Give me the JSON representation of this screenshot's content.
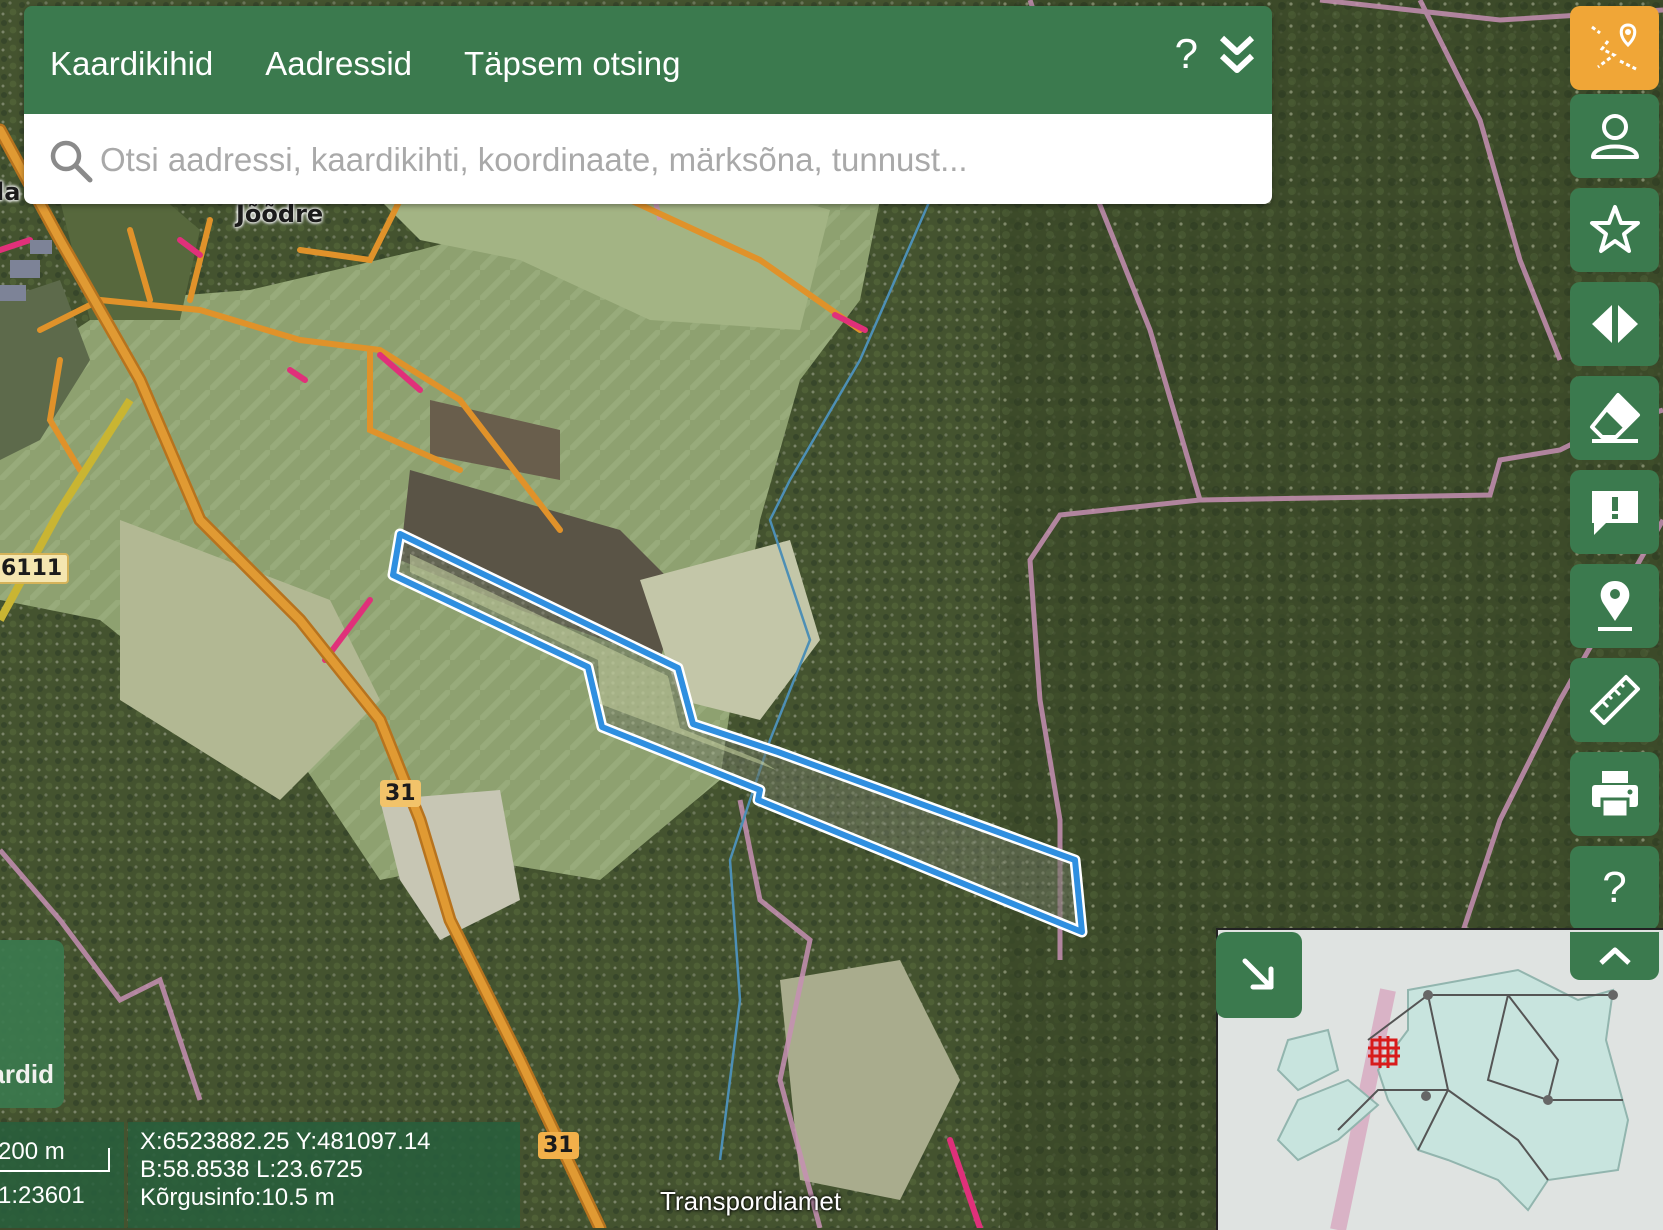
{
  "search": {
    "tabs": [
      "Kaardikihid",
      "Aadressid",
      "Täpsem otsing"
    ],
    "help_label": "?",
    "placeholder": "Otsi aadressi, kaardikihti, koordinaate, märksõna, tunnust..."
  },
  "map": {
    "place_label": "Jõõdre",
    "place_label_partial": "la",
    "road_labels": [
      "6111",
      "31",
      "31"
    ]
  },
  "toolbar": {
    "buttons": [
      {
        "name": "route-tool-button",
        "icon": "route-pin-icon",
        "active": true
      },
      {
        "name": "login-button",
        "icon": "user-icon"
      },
      {
        "name": "favorites-button",
        "icon": "star-icon"
      },
      {
        "name": "compare-button",
        "icon": "split-arrows-icon"
      },
      {
        "name": "clear-button",
        "icon": "eraser-icon"
      },
      {
        "name": "feedback-button",
        "icon": "message-alert-icon"
      },
      {
        "name": "location-button",
        "icon": "location-pin-icon"
      },
      {
        "name": "measure-button",
        "icon": "ruler-icon"
      },
      {
        "name": "print-button",
        "icon": "printer-icon"
      },
      {
        "name": "help-button",
        "icon": "question-icon",
        "label": "?"
      }
    ]
  },
  "layers_panel": {
    "label": "Kaardid"
  },
  "scale": {
    "label": "200 m",
    "value": "1:23601"
  },
  "coords": {
    "xy": "X:6523882.25 Y:481097.14",
    "bl": "B:58.8538 L:23.6725",
    "height": "Kõrgusinfo:10.5 m"
  },
  "attribution": "Transpordiamet",
  "colors": {
    "panel_green": "#3b7a4e",
    "active_orange": "#f0a637",
    "parcel_blue": "#2f8fe0",
    "road_orange": "#e0922a"
  }
}
